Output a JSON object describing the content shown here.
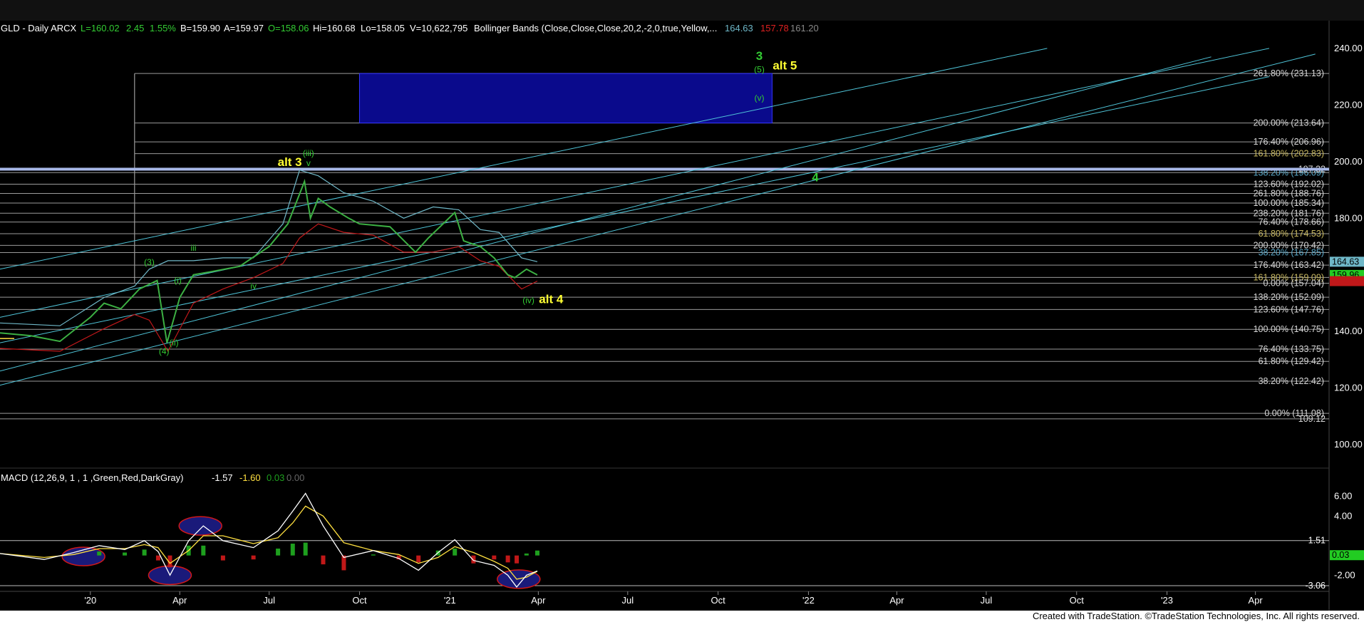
{
  "header": {
    "title": "GLD - Daily  ARCX",
    "last": "L=160.02",
    "change": "2.45",
    "change_pct": "1.55%",
    "bid": "B=159.90",
    "ask": "A=159.97",
    "open": "O=158.06",
    "high": "Hi=160.68",
    "low": "Lo=158.05",
    "volume": "V=10,622,795",
    "indicator": "Bollinger Bands (Close,Close,Close,20,2,-2,0,true,Yellow,...",
    "bb_upper": "164.63",
    "bb_lower": "157.78",
    "bb_mid": "161.20"
  },
  "macd_header": {
    "title": "MACD (12,26,9, 1 , 1 ,Green,Red,DarkGray)",
    "macd": "-1.57",
    "signal": "-1.60",
    "hist": "0.03",
    "zero": "0.00"
  },
  "footer": "Created with TradeStation. ©TradeStation Technologies, Inc. All rights reserved.",
  "colors": {
    "bg": "#000000",
    "grid": "#5a5a5a",
    "price": "#3cb043",
    "bb_upper": "#6fb8c8",
    "bb_lower": "#c0181a",
    "channel": "#4fc4d8",
    "fib_white": "#d8d8d8",
    "fib_gold": "#c8b860",
    "fib_blue": "#5aa8c8",
    "label_yellow": "#ffff33",
    "label_green": "#33cc33",
    "target_box": "#0a0a8c",
    "macd_line": "#ffffff",
    "signal_line": "#ffe040",
    "hist_pos": "#1ea01e",
    "hist_neg": "#c01818",
    "circle": "#1a1a7a",
    "circle_edge": "#d01818"
  },
  "chart_data": [
    {
      "type": "line",
      "title": "GLD - Daily ARCX",
      "ylim": [
        96,
        244
      ],
      "y_ticks": [
        100,
        120,
        140,
        160,
        180,
        200,
        220,
        240
      ],
      "y_tick_labels": [
        "100.00",
        "120.00",
        "140.00",
        "160.00",
        "180.00",
        "200.00",
        "220.00",
        "240.00"
      ],
      "x_ticks": [
        "'20",
        "Apr",
        "Jul",
        "Oct",
        "'21",
        "Apr",
        "Jul",
        "Oct",
        "'22",
        "Apr",
        "Jul",
        "Oct",
        "'23",
        "Apr"
      ],
      "price_series": {
        "name": "GLD",
        "x": [
          "2019-10-01",
          "2019-11-01",
          "2019-12-01",
          "2020-01-01",
          "2020-01-15",
          "2020-02-01",
          "2020-02-20",
          "2020-03-09",
          "2020-03-19",
          "2020-04-01",
          "2020-04-15",
          "2020-05-01",
          "2020-06-01",
          "2020-07-01",
          "2020-07-20",
          "2020-08-06",
          "2020-08-12",
          "2020-08-20",
          "2020-09-01",
          "2020-09-20",
          "2020-10-01",
          "2020-11-01",
          "2020-11-27",
          "2020-12-10",
          "2021-01-06",
          "2021-01-15",
          "2021-02-01",
          "2021-02-15",
          "2021-03-01",
          "2021-03-08",
          "2021-03-20",
          "2021-03-31"
        ],
        "y": [
          139.5,
          138.5,
          136.5,
          145,
          150,
          148,
          155,
          158,
          136,
          152,
          160,
          161,
          163,
          170,
          178,
          193,
          180,
          187,
          184,
          180,
          178,
          177,
          168,
          173,
          182,
          172,
          170,
          166,
          160,
          159,
          162,
          159.96
        ]
      },
      "bollinger_upper": {
        "x": [
          "2019-10-01",
          "2019-12-01",
          "2020-01-15",
          "2020-02-15",
          "2020-03-01",
          "2020-03-20",
          "2020-04-15",
          "2020-05-15",
          "2020-06-15",
          "2020-07-15",
          "2020-08-01",
          "2020-08-20",
          "2020-09-15",
          "2020-10-15",
          "2020-11-15",
          "2020-12-15",
          "2021-01-10",
          "2021-02-01",
          "2021-02-20",
          "2021-03-15",
          "2021-03-31"
        ],
        "y": [
          143,
          142,
          152,
          156,
          162,
          165,
          165,
          166,
          166,
          178,
          197,
          195,
          189,
          186,
          180,
          184,
          183,
          176,
          175,
          166,
          164.63
        ]
      },
      "bollinger_lower": {
        "x": [
          "2019-10-01",
          "2019-12-01",
          "2020-01-15",
          "2020-02-15",
          "2020-03-01",
          "2020-03-20",
          "2020-04-15",
          "2020-05-15",
          "2020-06-15",
          "2020-07-15",
          "2020-08-01",
          "2020-08-20",
          "2020-09-15",
          "2020-10-15",
          "2020-11-15",
          "2020-12-15",
          "2021-01-10",
          "2021-02-01",
          "2021-02-20",
          "2021-03-15",
          "2021-03-31"
        ],
        "y": [
          134,
          133,
          141,
          146,
          144,
          133,
          150,
          155,
          159,
          164,
          173,
          178,
          175,
          174,
          168,
          168,
          170,
          165,
          163,
          155,
          157.78
        ]
      },
      "channel_lines": [
        {
          "x": [
            "2019-10-01",
            "2022-09-01"
          ],
          "y": [
            162,
            240
          ]
        },
        {
          "x": [
            "2019-10-01",
            "2023-04-15"
          ],
          "y": [
            145,
            240
          ]
        },
        {
          "x": [
            "2019-10-01",
            "2023-04-15"
          ],
          "y": [
            136,
            230
          ]
        },
        {
          "x": [
            "2019-10-01",
            "2023-02-15"
          ],
          "y": [
            126,
            237
          ]
        },
        {
          "x": [
            "2019-10-01",
            "2023-06-01"
          ],
          "y": [
            121,
            238
          ]
        }
      ],
      "fib_levels": [
        {
          "label": "261.80% (231.13)",
          "value": 231.13,
          "color": "#d8d8d8"
        },
        {
          "label": "200.00% (213.64)",
          "value": 213.64,
          "color": "#d8d8d8"
        },
        {
          "label": "176.40% (206.96)",
          "value": 206.96,
          "color": "#d8d8d8"
        },
        {
          "label": "161.80% (202.83)",
          "value": 202.83,
          "color": "#c8b860"
        },
        {
          "label": "138.20% (196.09)",
          "value": 196.1,
          "color": "#5aa8c8"
        },
        {
          "label": "197.32",
          "value": 197.32,
          "color": "#d8d8d8"
        },
        {
          "label": "123.60% (192.02)",
          "value": 192.02,
          "color": "#d8d8d8"
        },
        {
          "label": "261.80% (188.76)",
          "value": 188.76,
          "color": "#d8d8d8"
        },
        {
          "label": "100.00% (185.34)",
          "value": 185.34,
          "color": "#d8d8d8"
        },
        {
          "label": "238.20% (181.76)",
          "value": 181.76,
          "color": "#d8d8d8"
        },
        {
          "label": "76.40% (178.66)",
          "value": 178.66,
          "color": "#d8d8d8"
        },
        {
          "label": "61.80% (174.53)",
          "value": 174.53,
          "color": "#c8b860"
        },
        {
          "label": "200.00% (170.42)",
          "value": 170.42,
          "color": "#d8d8d8"
        },
        {
          "label": "38.20% (167.85)",
          "value": 167.85,
          "color": "#5aa8c8"
        },
        {
          "label": "176.40% (163.42)",
          "value": 163.42,
          "color": "#d8d8d8"
        },
        {
          "label": "161.80% (159.09)",
          "value": 159.09,
          "color": "#c8b860"
        },
        {
          "label": "0.00% (157.04)",
          "value": 157.04,
          "color": "#d8d8d8"
        },
        {
          "label": "138.20% (152.09)",
          "value": 152.09,
          "color": "#d8d8d8"
        },
        {
          "label": "123.60% (147.76)",
          "value": 147.76,
          "color": "#d8d8d8"
        },
        {
          "label": "100.00% (140.75)",
          "value": 140.75,
          "color": "#d8d8d8"
        },
        {
          "label": "76.40% (133.75)",
          "value": 133.75,
          "color": "#d8d8d8"
        },
        {
          "label": "61.80% (129.42)",
          "value": 129.42,
          "color": "#d8d8d8"
        },
        {
          "label": "38.20% (122.42)",
          "value": 122.42,
          "color": "#d8d8d8"
        },
        {
          "label": "0.00% (111.08)",
          "value": 111.08,
          "color": "#d8d8d8"
        },
        {
          "label": "109.12",
          "value": 109.12,
          "color": "#d8d8d8"
        }
      ],
      "horizontal_band": {
        "value": 197.32,
        "color": "#a8b8e8"
      },
      "target_box": {
        "x": [
          "2020-10-01",
          "2021-11-25"
        ],
        "y": [
          213.64,
          231.13
        ]
      },
      "wave_labels": [
        {
          "text": "3",
          "x": "2021-11-12",
          "y": 236,
          "color": "#33cc33",
          "size": "large"
        },
        {
          "text": "alt 5",
          "x": "2021-12-08",
          "y": 232.5,
          "color": "#ffff33",
          "size": "large"
        },
        {
          "text": "(5)",
          "x": "2021-11-12",
          "y": 231.5,
          "color": "#33cc33",
          "size": "small"
        },
        {
          "text": "(v)",
          "x": "2021-11-12",
          "y": 221.5,
          "color": "#33cc33",
          "size": "small"
        },
        {
          "text": "alt 3",
          "x": "2020-07-22",
          "y": 198.5,
          "color": "#ffff33",
          "size": "large"
        },
        {
          "text": "(iii)",
          "x": "2020-08-10",
          "y": 202,
          "color": "#33cc33",
          "size": "small"
        },
        {
          "text": "v",
          "x": "2020-08-10",
          "y": 198.5,
          "color": "#33cc33",
          "size": "small"
        },
        {
          "text": "4",
          "x": "2022-01-08",
          "y": 193,
          "color": "#33cc33",
          "size": "large"
        },
        {
          "text": "(3)",
          "x": "2020-03-01",
          "y": 163.5,
          "color": "#33cc33",
          "size": "small"
        },
        {
          "text": "iii",
          "x": "2020-04-15",
          "y": 168.5,
          "color": "#33cc33",
          "size": "small"
        },
        {
          "text": "(i)",
          "x": "2020-03-30",
          "y": 157,
          "color": "#33cc33",
          "size": "small"
        },
        {
          "text": "iv",
          "x": "2020-06-15",
          "y": 155,
          "color": "#33cc33",
          "size": "small"
        },
        {
          "text": "(ii)",
          "x": "2020-03-26",
          "y": 135,
          "color": "#33cc33",
          "size": "small"
        },
        {
          "text": "(4)",
          "x": "2020-03-16",
          "y": 132,
          "color": "#33cc33",
          "size": "small"
        },
        {
          "text": "(iv)",
          "x": "2021-03-22",
          "y": 150,
          "color": "#33cc33",
          "size": "small"
        },
        {
          "text": "alt 4",
          "x": "2021-04-14",
          "y": 150,
          "color": "#ffff33",
          "size": "large"
        }
      ],
      "last_price_tags": [
        {
          "text": "164.63",
          "value": 164.63,
          "bg": "#6fb8c8",
          "fg": "#000000"
        },
        {
          "text": "159.96",
          "value": 159.96,
          "bg": "#22cc22",
          "fg": "#000000"
        },
        {
          "text": "157.78",
          "value": 157.78,
          "bg": "#c0181a",
          "fg": "#c0181a"
        }
      ]
    },
    {
      "type": "line",
      "title": "MACD (12,26,9, 1 , 1 ,Green,Red,DarkGray)",
      "ylim": [
        -4,
        7.2
      ],
      "y_ticks": [
        6,
        4,
        -2
      ],
      "y_tick_labels": [
        "6.00",
        "4.00",
        "-2.00"
      ],
      "ref_lines": [
        {
          "label": "1.51",
          "value": 1.51
        },
        {
          "label": "-3.06",
          "value": -3.06
        }
      ],
      "hist_tag": {
        "text": "0.03",
        "value": 0.03
      },
      "macd": {
        "x": [
          "2019-10-01",
          "2019-11-15",
          "2019-12-15",
          "2020-01-10",
          "2020-02-05",
          "2020-02-25",
          "2020-03-10",
          "2020-03-22",
          "2020-04-10",
          "2020-04-25",
          "2020-05-15",
          "2020-06-15",
          "2020-07-10",
          "2020-07-25",
          "2020-08-07",
          "2020-08-25",
          "2020-09-15",
          "2020-10-15",
          "2020-11-10",
          "2020-11-30",
          "2020-12-20",
          "2021-01-06",
          "2021-01-25",
          "2021-02-15",
          "2021-03-01",
          "2021-03-10",
          "2021-03-20",
          "2021-03-31"
        ],
        "y": [
          0.2,
          -0.4,
          0.3,
          1.0,
          0.6,
          1.5,
          0.4,
          -2.0,
          1.5,
          3.0,
          1.5,
          0.8,
          2.5,
          4.5,
          6.3,
          3.0,
          -0.2,
          0.5,
          -0.3,
          -1.5,
          0.3,
          1.6,
          -0.5,
          -1.0,
          -2.0,
          -3.2,
          -2.0,
          -1.57
        ]
      },
      "signal": {
        "x": [
          "2019-10-01",
          "2019-11-15",
          "2019-12-15",
          "2020-01-10",
          "2020-02-05",
          "2020-02-25",
          "2020-03-10",
          "2020-03-22",
          "2020-04-10",
          "2020-04-25",
          "2020-05-15",
          "2020-06-15",
          "2020-07-10",
          "2020-07-25",
          "2020-08-07",
          "2020-08-25",
          "2020-09-15",
          "2020-10-15",
          "2020-11-10",
          "2020-11-30",
          "2020-12-20",
          "2021-01-06",
          "2021-01-25",
          "2021-02-15",
          "2021-03-01",
          "2021-03-10",
          "2021-03-20",
          "2021-03-31"
        ],
        "y": [
          0.2,
          -0.2,
          0.1,
          0.7,
          0.7,
          1.1,
          0.8,
          -0.8,
          0.5,
          2.0,
          2.0,
          1.2,
          1.8,
          3.3,
          5.0,
          4.0,
          1.3,
          0.5,
          0.1,
          -0.8,
          -0.2,
          0.9,
          0.3,
          -0.6,
          -1.3,
          -2.4,
          -2.2,
          -1.6
        ]
      },
      "histogram": {
        "x": [
          "2020-01-10",
          "2020-02-05",
          "2020-02-25",
          "2020-03-10",
          "2020-03-22",
          "2020-04-10",
          "2020-04-25",
          "2020-05-15",
          "2020-06-15",
          "2020-07-10",
          "2020-07-25",
          "2020-08-07",
          "2020-08-25",
          "2020-09-15",
          "2020-10-15",
          "2020-11-10",
          "2020-11-30",
          "2020-12-20",
          "2021-01-06",
          "2021-01-25",
          "2021-02-15",
          "2021-03-01",
          "2021-03-10",
          "2021-03-20",
          "2021-03-31"
        ],
        "y": [
          0.4,
          0.3,
          0.6,
          -0.5,
          -1.2,
          1.0,
          1.0,
          -0.5,
          -0.4,
          0.7,
          1.2,
          1.3,
          -0.9,
          -1.5,
          0.1,
          -0.4,
          -0.7,
          0.5,
          0.7,
          -0.8,
          -0.4,
          -0.7,
          -0.8,
          0.2,
          0.5
        ]
      },
      "circles": [
        {
          "x": "2019-12-25",
          "y": -0.1
        },
        {
          "x": "2020-03-22",
          "y": -2.0
        },
        {
          "x": "2020-04-22",
          "y": 3.0
        },
        {
          "x": "2021-03-12",
          "y": -2.4
        }
      ]
    }
  ]
}
